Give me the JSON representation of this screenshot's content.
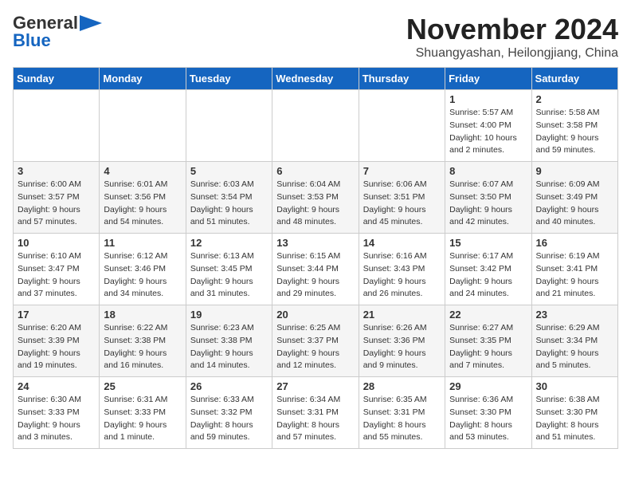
{
  "header": {
    "logo_general": "General",
    "logo_blue": "Blue",
    "month_title": "November 2024",
    "location": "Shuangyashan, Heilongjiang, China"
  },
  "weekdays": [
    "Sunday",
    "Monday",
    "Tuesday",
    "Wednesday",
    "Thursday",
    "Friday",
    "Saturday"
  ],
  "weeks": [
    [
      {
        "day": "",
        "info": ""
      },
      {
        "day": "",
        "info": ""
      },
      {
        "day": "",
        "info": ""
      },
      {
        "day": "",
        "info": ""
      },
      {
        "day": "",
        "info": ""
      },
      {
        "day": "1",
        "info": "Sunrise: 5:57 AM\nSunset: 4:00 PM\nDaylight: 10 hours\nand 2 minutes."
      },
      {
        "day": "2",
        "info": "Sunrise: 5:58 AM\nSunset: 3:58 PM\nDaylight: 9 hours\nand 59 minutes."
      }
    ],
    [
      {
        "day": "3",
        "info": "Sunrise: 6:00 AM\nSunset: 3:57 PM\nDaylight: 9 hours\nand 57 minutes."
      },
      {
        "day": "4",
        "info": "Sunrise: 6:01 AM\nSunset: 3:56 PM\nDaylight: 9 hours\nand 54 minutes."
      },
      {
        "day": "5",
        "info": "Sunrise: 6:03 AM\nSunset: 3:54 PM\nDaylight: 9 hours\nand 51 minutes."
      },
      {
        "day": "6",
        "info": "Sunrise: 6:04 AM\nSunset: 3:53 PM\nDaylight: 9 hours\nand 48 minutes."
      },
      {
        "day": "7",
        "info": "Sunrise: 6:06 AM\nSunset: 3:51 PM\nDaylight: 9 hours\nand 45 minutes."
      },
      {
        "day": "8",
        "info": "Sunrise: 6:07 AM\nSunset: 3:50 PM\nDaylight: 9 hours\nand 42 minutes."
      },
      {
        "day": "9",
        "info": "Sunrise: 6:09 AM\nSunset: 3:49 PM\nDaylight: 9 hours\nand 40 minutes."
      }
    ],
    [
      {
        "day": "10",
        "info": "Sunrise: 6:10 AM\nSunset: 3:47 PM\nDaylight: 9 hours\nand 37 minutes."
      },
      {
        "day": "11",
        "info": "Sunrise: 6:12 AM\nSunset: 3:46 PM\nDaylight: 9 hours\nand 34 minutes."
      },
      {
        "day": "12",
        "info": "Sunrise: 6:13 AM\nSunset: 3:45 PM\nDaylight: 9 hours\nand 31 minutes."
      },
      {
        "day": "13",
        "info": "Sunrise: 6:15 AM\nSunset: 3:44 PM\nDaylight: 9 hours\nand 29 minutes."
      },
      {
        "day": "14",
        "info": "Sunrise: 6:16 AM\nSunset: 3:43 PM\nDaylight: 9 hours\nand 26 minutes."
      },
      {
        "day": "15",
        "info": "Sunrise: 6:17 AM\nSunset: 3:42 PM\nDaylight: 9 hours\nand 24 minutes."
      },
      {
        "day": "16",
        "info": "Sunrise: 6:19 AM\nSunset: 3:41 PM\nDaylight: 9 hours\nand 21 minutes."
      }
    ],
    [
      {
        "day": "17",
        "info": "Sunrise: 6:20 AM\nSunset: 3:39 PM\nDaylight: 9 hours\nand 19 minutes."
      },
      {
        "day": "18",
        "info": "Sunrise: 6:22 AM\nSunset: 3:38 PM\nDaylight: 9 hours\nand 16 minutes."
      },
      {
        "day": "19",
        "info": "Sunrise: 6:23 AM\nSunset: 3:38 PM\nDaylight: 9 hours\nand 14 minutes."
      },
      {
        "day": "20",
        "info": "Sunrise: 6:25 AM\nSunset: 3:37 PM\nDaylight: 9 hours\nand 12 minutes."
      },
      {
        "day": "21",
        "info": "Sunrise: 6:26 AM\nSunset: 3:36 PM\nDaylight: 9 hours\nand 9 minutes."
      },
      {
        "day": "22",
        "info": "Sunrise: 6:27 AM\nSunset: 3:35 PM\nDaylight: 9 hours\nand 7 minutes."
      },
      {
        "day": "23",
        "info": "Sunrise: 6:29 AM\nSunset: 3:34 PM\nDaylight: 9 hours\nand 5 minutes."
      }
    ],
    [
      {
        "day": "24",
        "info": "Sunrise: 6:30 AM\nSunset: 3:33 PM\nDaylight: 9 hours\nand 3 minutes."
      },
      {
        "day": "25",
        "info": "Sunrise: 6:31 AM\nSunset: 3:33 PM\nDaylight: 9 hours\nand 1 minute."
      },
      {
        "day": "26",
        "info": "Sunrise: 6:33 AM\nSunset: 3:32 PM\nDaylight: 8 hours\nand 59 minutes."
      },
      {
        "day": "27",
        "info": "Sunrise: 6:34 AM\nSunset: 3:31 PM\nDaylight: 8 hours\nand 57 minutes."
      },
      {
        "day": "28",
        "info": "Sunrise: 6:35 AM\nSunset: 3:31 PM\nDaylight: 8 hours\nand 55 minutes."
      },
      {
        "day": "29",
        "info": "Sunrise: 6:36 AM\nSunset: 3:30 PM\nDaylight: 8 hours\nand 53 minutes."
      },
      {
        "day": "30",
        "info": "Sunrise: 6:38 AM\nSunset: 3:30 PM\nDaylight: 8 hours\nand 51 minutes."
      }
    ]
  ]
}
